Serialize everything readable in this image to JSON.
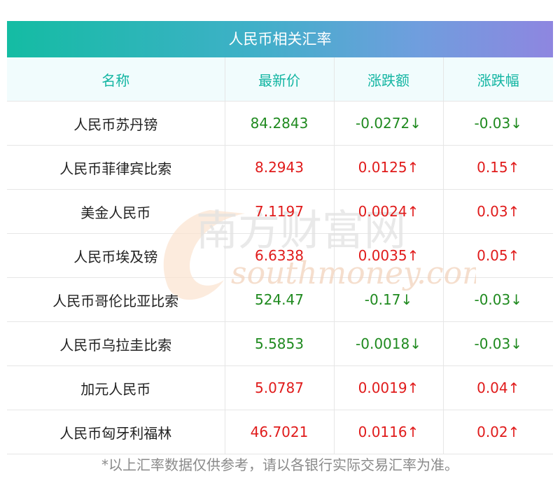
{
  "table": {
    "title": "人民币相关汇率",
    "headers": [
      "名称",
      "最新价",
      "涨跌额",
      "涨跌幅"
    ],
    "rows": [
      {
        "name": "人民币苏丹镑",
        "price": "84.2843",
        "change": "-0.0272↓",
        "pct": "-0.03↓",
        "dir": "down"
      },
      {
        "name": "人民币菲律宾比索",
        "price": "8.2943",
        "change": "0.0125↑",
        "pct": "0.15↑",
        "dir": "up"
      },
      {
        "name": "美金人民币",
        "price": "7.1197",
        "change": "0.0024↑",
        "pct": "0.03↑",
        "dir": "up"
      },
      {
        "name": "人民币埃及镑",
        "price": "6.6338",
        "change": "0.0035↑",
        "pct": "0.05↑",
        "dir": "up"
      },
      {
        "name": "人民币哥伦比亚比索",
        "price": "524.47",
        "change": "-0.17↓",
        "pct": "-0.03↓",
        "dir": "down"
      },
      {
        "name": "人民币乌拉圭比索",
        "price": "5.5853",
        "change": "-0.0018↓",
        "pct": "-0.03↓",
        "dir": "down"
      },
      {
        "name": "加元人民币",
        "price": "5.0787",
        "change": "0.0019↑",
        "pct": "0.04↑",
        "dir": "up"
      },
      {
        "name": "人民币匈牙利福林",
        "price": "46.7021",
        "change": "0.0116↑",
        "pct": "0.02↑",
        "dir": "up"
      }
    ]
  },
  "watermark": {
    "cn": "南方财富网",
    "en": "southmoney.com"
  },
  "footer": {
    "note": "*以上汇率数据仅供参考，请以各银行实际交易汇率为准。"
  },
  "colors": {
    "up": "#e01b1b",
    "down": "#1f8a1f",
    "header_text": "#12b5a2"
  }
}
